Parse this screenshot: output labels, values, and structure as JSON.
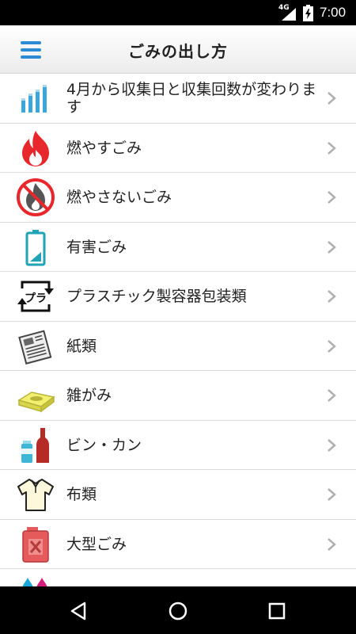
{
  "status": {
    "network": "4G",
    "time": "7:00"
  },
  "header": {
    "title": "ごみの出し方",
    "menu_icon": "hamburger-menu-icon"
  },
  "colors": {
    "accent": "#2b8bd4",
    "chevron": "#b0b0b0"
  },
  "items": [
    {
      "label": "4月から収集日と収集回数が変わります",
      "icon": "bar-chart-icon"
    },
    {
      "label": "燃やすごみ",
      "icon": "flame-icon"
    },
    {
      "label": "燃やさないごみ",
      "icon": "no-burn-icon"
    },
    {
      "label": "有害ごみ",
      "icon": "battery-icon"
    },
    {
      "label": "プラスチック製容器包装類",
      "icon": "plastic-recycle-icon"
    },
    {
      "label": "紙類",
      "icon": "newspaper-icon"
    },
    {
      "label": "雑がみ",
      "icon": "tissue-box-icon"
    },
    {
      "label": "ビン・カン",
      "icon": "bottle-can-icon"
    },
    {
      "label": "布類",
      "icon": "shirt-icon"
    },
    {
      "label": "大型ごみ",
      "icon": "oil-can-icon"
    },
    {
      "label": "",
      "icon": "drops-icon"
    }
  ],
  "nav": {
    "back": "back-icon",
    "home": "home-icon",
    "recent": "recent-apps-icon"
  }
}
